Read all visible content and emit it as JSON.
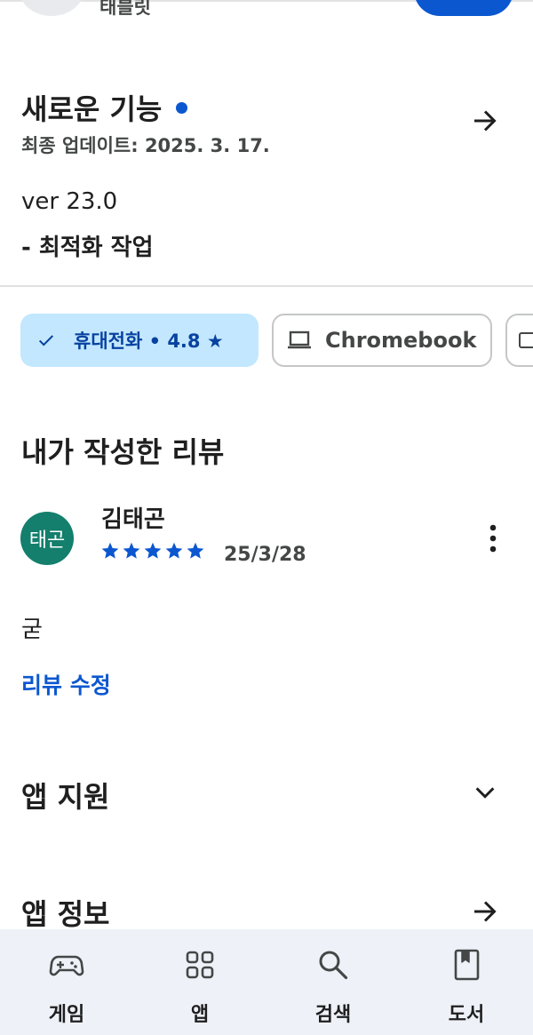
{
  "top": {
    "partial_label": "태블릿"
  },
  "whats_new": {
    "title": "새로운 기능",
    "updated": "최종 업데이트: 2025. 3. 17.",
    "version": "ver 23.0",
    "notes": "- 최적화 작업"
  },
  "device_chips": {
    "phone_label": "휴대전화 • 4.8 ★",
    "chromebook_label": "Chromebook"
  },
  "review": {
    "section_title": "내가 작성한 리뷰",
    "avatar_text": "태곤",
    "reviewer_name": "김태곤",
    "rating": 5,
    "rating_max": 5,
    "date": "25/3/28",
    "text": "굳",
    "edit_label": "리뷰 수정"
  },
  "app_support": {
    "title": "앱 지원"
  },
  "app_info": {
    "title": "앱 정보"
  },
  "bottom_nav": {
    "items": [
      {
        "label": "게임",
        "icon": "gamepad-icon"
      },
      {
        "label": "앱",
        "icon": "apps-grid-icon"
      },
      {
        "label": "검색",
        "icon": "search-icon"
      },
      {
        "label": "도서",
        "icon": "book-icon"
      }
    ]
  },
  "colors": {
    "accent": "#0b57d0",
    "chip_selected_bg": "#c2e7ff",
    "chip_selected_text": "#0842a0",
    "avatar_bg": "#137f6c",
    "nav_bg": "#eef2f8"
  }
}
